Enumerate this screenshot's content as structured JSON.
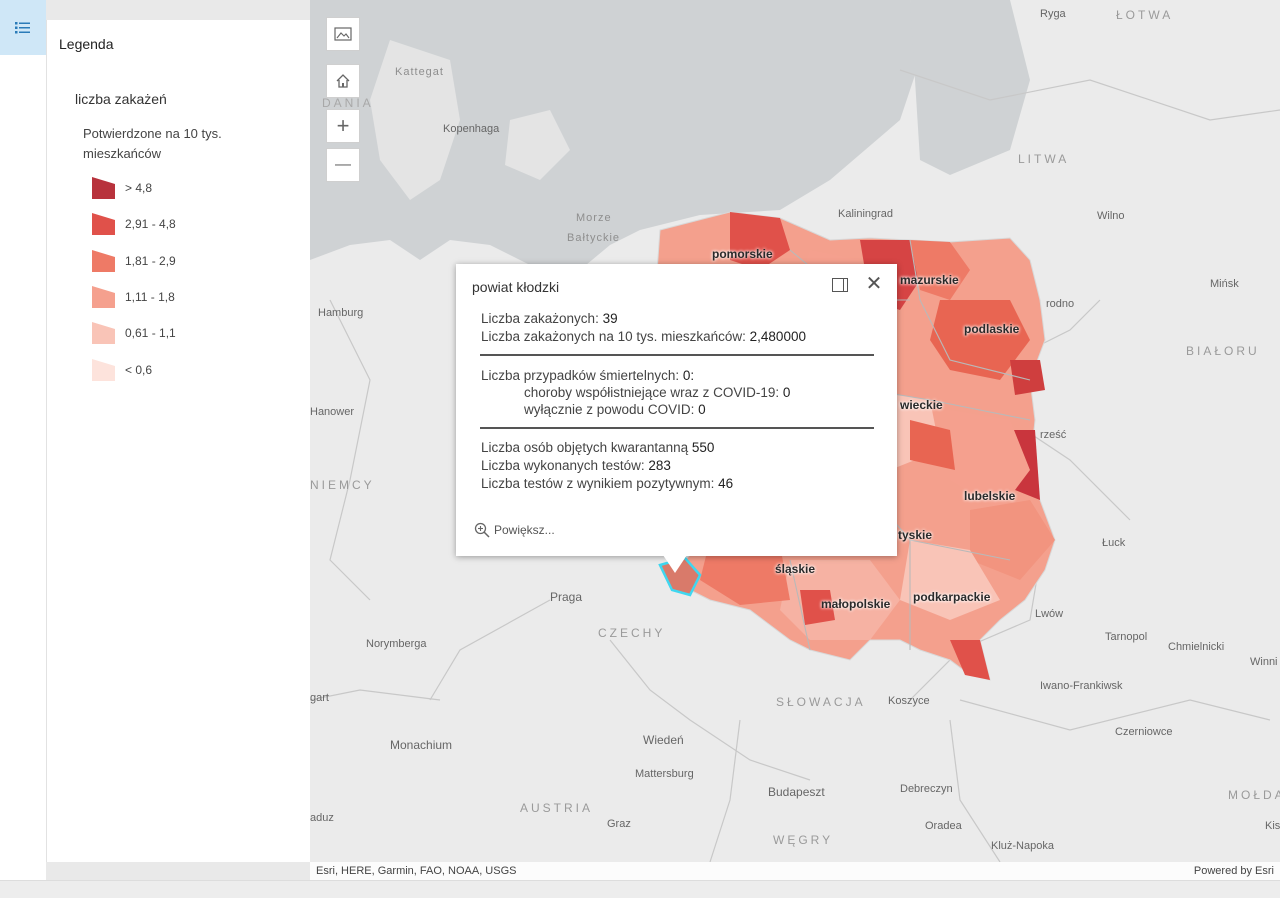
{
  "legend": {
    "title": "Legenda",
    "layer_title": "liczba zakażeń",
    "field_label": "Potwierdzone na 10 tys. mieszkańców",
    "items": [
      {
        "label": "> 4,8",
        "color": "#b8323c"
      },
      {
        "label": "2,91 - 4,8",
        "color": "#e0514a"
      },
      {
        "label": "1,81 - 2,9",
        "color": "#ee7a66"
      },
      {
        "label": "1,11 - 1,8",
        "color": "#f5a08e"
      },
      {
        "label": "0,61 - 1,1",
        "color": "#f9c4b7"
      },
      {
        "label": "< 0,6",
        "color": "#fde3dc"
      }
    ]
  },
  "icons": {
    "legend_toggle": "legend-list-icon",
    "basemap": "basemap-gallery-icon",
    "home": "home-icon",
    "zoom_in": "zoom-in-icon",
    "zoom_out": "zoom-out-icon",
    "dock": "dock-icon",
    "close": "close-icon",
    "zoom_to": "zoom-magnifier-icon"
  },
  "map_controls": {
    "zoom_in": "+",
    "zoom_out": "—",
    "close": "✕"
  },
  "map_labels": {
    "regions": [
      "pomorskie",
      "mazurskie",
      "podlaskie",
      "wieckie",
      "lubelskie",
      "tyskie",
      "śląskie",
      "małopolskie",
      "podkarpackie"
    ],
    "places": [
      "Ryga",
      "Kattegat",
      "Kopenhaga",
      "Kaliningrad",
      "Wilno",
      "Mińsk",
      "Hamburg",
      "Hanower",
      "rodno",
      "rześć",
      "Łuck",
      "Lwów",
      "Tarnopol",
      "Chmielnicki",
      "Winni",
      "Iwano-Frankiwsk",
      "Praga",
      "Norymberga",
      "gart",
      "Koszyce",
      "Monachium",
      "Wiedeń",
      "Mattersburg",
      "Budapeszt",
      "Debreczyn",
      "Czerniowce",
      "Graz",
      "Oradea",
      "Kluż-Napoka",
      "aduz",
      "Kis"
    ],
    "countries": [
      "ŁOTWA",
      "LITWA",
      "BIAŁORU",
      "NIEMCY",
      "CZECHY",
      "SŁOWACJA",
      "AUSTRIA",
      "WĘGRY",
      "MOŁDA",
      "DANIA"
    ],
    "seas": [
      "Morze",
      "Bałtyckie"
    ]
  },
  "popup": {
    "title": "powiat kłodzki",
    "cases_label": "Liczba zakażonych:",
    "cases_value": "39",
    "rate_label": "Liczba zakażonych na 10 tys. mieszkańców:",
    "rate_value": "2,480000",
    "deaths_label": "Liczba przypadków śmiertelnych:",
    "deaths_value": "0:",
    "comorb_label": "choroby współistniejące wraz z COVID-19:",
    "comorb_value": "0",
    "covid_only_label": "wyłącznie z powodu COVID:",
    "covid_only_value": "0",
    "quarantine_label": "Liczba osób objętych kwarantanną",
    "quarantine_value": "550",
    "tests_label": "Liczba wykonanych testów:",
    "tests_value": "283",
    "positive_label": "Liczba testów z wynikiem pozytywnym:",
    "positive_value": "46",
    "zoom_label": "Powiększ..."
  },
  "attribution": "Esri, HERE, Garmin, FAO, NOAA, USGS",
  "powered_by": "Powered by Esri"
}
